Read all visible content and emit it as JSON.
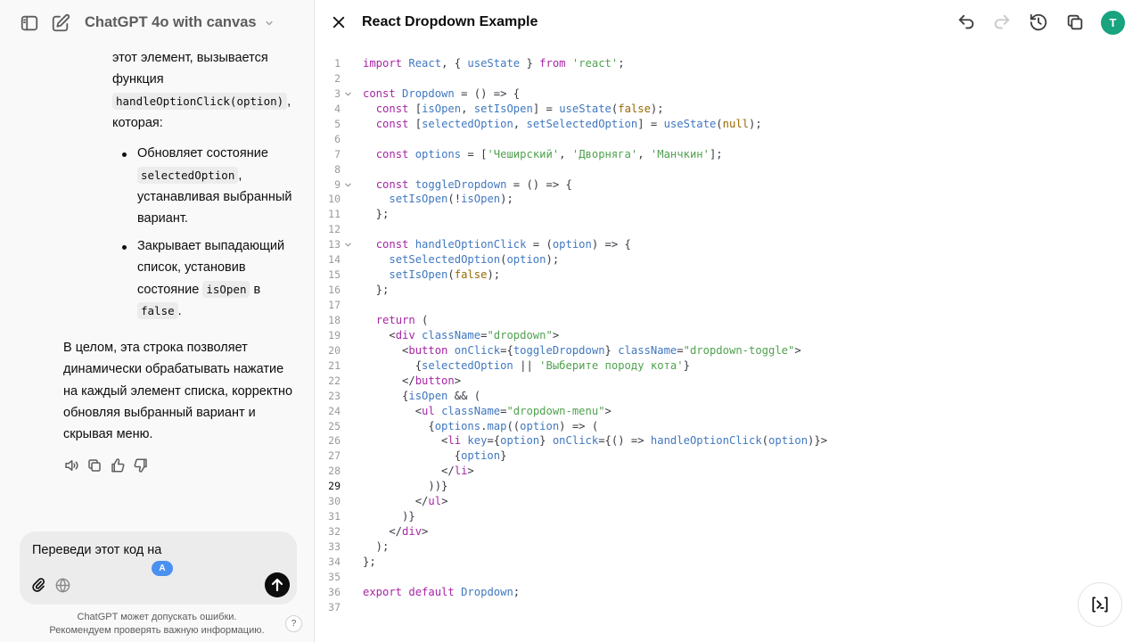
{
  "header": {
    "model_name": "ChatGPT 4o with canvas",
    "sidebar_toggle_icon": "sidebar-icon",
    "new_chat_icon": "edit-icon"
  },
  "chat": {
    "lines": [
      "этот элемент, вызывается",
      "функция",
      "handleOptionClick(option)",
      ",",
      "которая:"
    ],
    "bullets": [
      {
        "l1": "Обновляет состояние",
        "l2_code": "selectedOption",
        "l2_tail": ",",
        "l3": "устанавливая выбранный",
        "l4": "вариант."
      },
      {
        "l1": "Закрывает выпадающий",
        "l2": "список, установив",
        "l3_pre": "состояние",
        "l3_code": "isOpen",
        "l3_tail": "в",
        "l4_code": "false",
        "l4_tail": "."
      }
    ],
    "summary": [
      "В целом, эта строка позволяет",
      "динамически обрабатывать нажатие",
      "на каждый элемент списка, корректно",
      "обновляя выбранный вариант и",
      "скрывая меню."
    ]
  },
  "composer": {
    "text": "Переведи этот код на",
    "badge": "A"
  },
  "footer": {
    "line1": "ChatGPT может допускать ошибки.",
    "line2": "Рекомендуем проверять важную информацию.",
    "help": "?"
  },
  "canvas": {
    "title": "React Dropdown Example",
    "avatar_letter": "T",
    "current_line": 29,
    "code": [
      [
        [
          "k",
          "import"
        ],
        [
          "p",
          " "
        ],
        [
          "i",
          "React"
        ],
        [
          "p",
          ", { "
        ],
        [
          "i",
          "useState"
        ],
        [
          "p",
          " } "
        ],
        [
          "k",
          "from"
        ],
        [
          "p",
          " "
        ],
        [
          "s",
          "'react'"
        ],
        [
          "p",
          ";"
        ]
      ],
      [],
      [
        [
          "k",
          "const"
        ],
        [
          "p",
          " "
        ],
        [
          "i",
          "Dropdown"
        ],
        [
          "p",
          " = () => {"
        ]
      ],
      [
        [
          "p",
          "  "
        ],
        [
          "k",
          "const"
        ],
        [
          "p",
          " ["
        ],
        [
          "i",
          "isOpen"
        ],
        [
          "p",
          ", "
        ],
        [
          "i",
          "setIsOpen"
        ],
        [
          "p",
          "] = "
        ],
        [
          "i",
          "useState"
        ],
        [
          "p",
          "("
        ],
        [
          "n",
          "false"
        ],
        [
          "p",
          ");"
        ]
      ],
      [
        [
          "p",
          "  "
        ],
        [
          "k",
          "const"
        ],
        [
          "p",
          " ["
        ],
        [
          "i",
          "selectedOption"
        ],
        [
          "p",
          ", "
        ],
        [
          "i",
          "setSelectedOption"
        ],
        [
          "p",
          "] = "
        ],
        [
          "i",
          "useState"
        ],
        [
          "p",
          "("
        ],
        [
          "n",
          "null"
        ],
        [
          "p",
          ");"
        ]
      ],
      [],
      [
        [
          "p",
          "  "
        ],
        [
          "k",
          "const"
        ],
        [
          "p",
          " "
        ],
        [
          "i",
          "options"
        ],
        [
          "p",
          " = ["
        ],
        [
          "s",
          "'Чеширский'"
        ],
        [
          "p",
          ", "
        ],
        [
          "s",
          "'Дворняга'"
        ],
        [
          "p",
          ", "
        ],
        [
          "s",
          "'Манчкин'"
        ],
        [
          "p",
          "];"
        ]
      ],
      [],
      [
        [
          "p",
          "  "
        ],
        [
          "k",
          "const"
        ],
        [
          "p",
          " "
        ],
        [
          "i",
          "toggleDropdown"
        ],
        [
          "p",
          " = () => {"
        ]
      ],
      [
        [
          "p",
          "    "
        ],
        [
          "i",
          "setIsOpen"
        ],
        [
          "p",
          "(!"
        ],
        [
          "i",
          "isOpen"
        ],
        [
          "p",
          ");"
        ]
      ],
      [
        [
          "p",
          "  };"
        ]
      ],
      [],
      [
        [
          "p",
          "  "
        ],
        [
          "k",
          "const"
        ],
        [
          "p",
          " "
        ],
        [
          "i",
          "handleOptionClick"
        ],
        [
          "p",
          " = ("
        ],
        [
          "i",
          "option"
        ],
        [
          "p",
          ") => {"
        ]
      ],
      [
        [
          "p",
          "    "
        ],
        [
          "i",
          "setSelectedOption"
        ],
        [
          "p",
          "("
        ],
        [
          "i",
          "option"
        ],
        [
          "p",
          ");"
        ]
      ],
      [
        [
          "p",
          "    "
        ],
        [
          "i",
          "setIsOpen"
        ],
        [
          "p",
          "("
        ],
        [
          "n",
          "false"
        ],
        [
          "p",
          ");"
        ]
      ],
      [
        [
          "p",
          "  };"
        ]
      ],
      [],
      [
        [
          "p",
          "  "
        ],
        [
          "k",
          "return"
        ],
        [
          "p",
          " ("
        ]
      ],
      [
        [
          "p",
          "    <"
        ],
        [
          "k",
          "div"
        ],
        [
          "p",
          " "
        ],
        [
          "i",
          "className"
        ],
        [
          "p",
          "="
        ],
        [
          "s",
          "\"dropdown\""
        ],
        [
          "p",
          ">"
        ]
      ],
      [
        [
          "p",
          "      <"
        ],
        [
          "k",
          "button"
        ],
        [
          "p",
          " "
        ],
        [
          "i",
          "onClick"
        ],
        [
          "p",
          "={"
        ],
        [
          "i",
          "toggleDropdown"
        ],
        [
          "p",
          "} "
        ],
        [
          "i",
          "className"
        ],
        [
          "p",
          "="
        ],
        [
          "s",
          "\"dropdown-toggle\""
        ],
        [
          "p",
          ">"
        ]
      ],
      [
        [
          "p",
          "        {"
        ],
        [
          "i",
          "selectedOption"
        ],
        [
          "p",
          " || "
        ],
        [
          "s",
          "'Выберите породу кота'"
        ],
        [
          "p",
          "}"
        ]
      ],
      [
        [
          "p",
          "      </"
        ],
        [
          "k",
          "button"
        ],
        [
          "p",
          ">"
        ]
      ],
      [
        [
          "p",
          "      {"
        ],
        [
          "i",
          "isOpen"
        ],
        [
          "p",
          " && ("
        ]
      ],
      [
        [
          "p",
          "        <"
        ],
        [
          "k",
          "ul"
        ],
        [
          "p",
          " "
        ],
        [
          "i",
          "className"
        ],
        [
          "p",
          "="
        ],
        [
          "s",
          "\"dropdown-menu\""
        ],
        [
          "p",
          ">"
        ]
      ],
      [
        [
          "p",
          "          {"
        ],
        [
          "i",
          "options"
        ],
        [
          "p",
          "."
        ],
        [
          "i",
          "map"
        ],
        [
          "p",
          "(("
        ],
        [
          "i",
          "option"
        ],
        [
          "p",
          ") => ("
        ]
      ],
      [
        [
          "p",
          "            <"
        ],
        [
          "k",
          "li"
        ],
        [
          "p",
          " "
        ],
        [
          "i",
          "key"
        ],
        [
          "p",
          "={"
        ],
        [
          "i",
          "option"
        ],
        [
          "p",
          "} "
        ],
        [
          "i",
          "onClick"
        ],
        [
          "p",
          "={() => "
        ],
        [
          "i",
          "handleOptionClick"
        ],
        [
          "p",
          "("
        ],
        [
          "i",
          "option"
        ],
        [
          "p",
          ")}>"
        ]
      ],
      [
        [
          "p",
          "              {"
        ],
        [
          "i",
          "option"
        ],
        [
          "p",
          "}"
        ]
      ],
      [
        [
          "p",
          "            </"
        ],
        [
          "k",
          "li"
        ],
        [
          "p",
          ">"
        ]
      ],
      [
        [
          "p",
          "          ))}"
        ]
      ],
      [
        [
          "p",
          "        </"
        ],
        [
          "k",
          "ul"
        ],
        [
          "p",
          ">"
        ]
      ],
      [
        [
          "p",
          "      )}"
        ]
      ],
      [
        [
          "p",
          "    </"
        ],
        [
          "k",
          "div"
        ],
        [
          "p",
          ">"
        ]
      ],
      [
        [
          "p",
          "  );"
        ]
      ],
      [
        [
          "p",
          "};"
        ]
      ],
      [],
      [
        [
          "k",
          "export"
        ],
        [
          "p",
          " "
        ],
        [
          "k",
          "default"
        ],
        [
          "p",
          " "
        ],
        [
          "i",
          "Dropdown"
        ],
        [
          "p",
          ";"
        ]
      ],
      []
    ],
    "fold_lines": [
      3,
      9,
      13
    ]
  },
  "colors": {
    "keyword": "#a626a4",
    "identifier": "#4078c0",
    "string": "#50a14f",
    "number": "#986801",
    "avatar": "#19a37f",
    "badge": "#4a90f0"
  }
}
